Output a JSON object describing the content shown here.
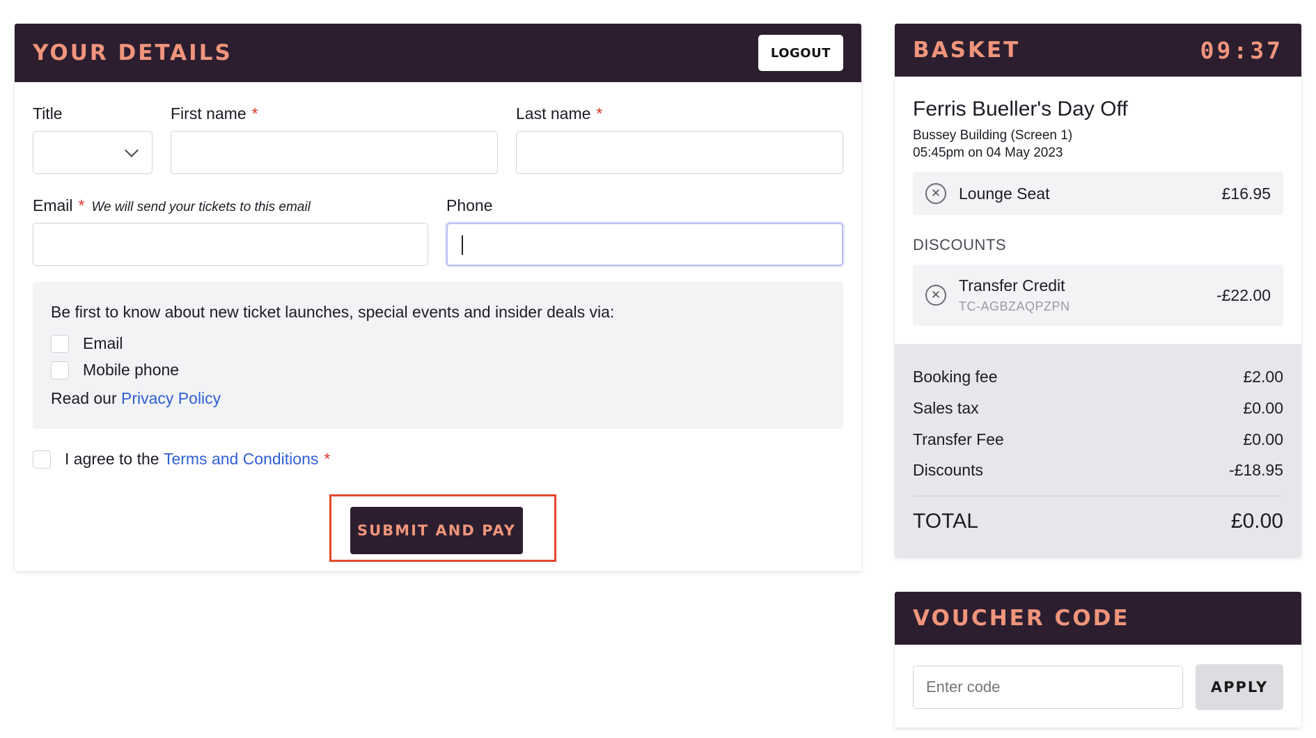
{
  "details": {
    "heading": "YOUR DETAILS",
    "logout_label": "LOGOUT",
    "title_label": "Title",
    "title_value": "",
    "first_name_label": "First name",
    "last_name_label": "Last name",
    "email_label": "Email",
    "email_hint": "We will send your tickets to this email",
    "phone_label": "Phone",
    "required_mark": "*",
    "optin_text": "Be first to know about new ticket launches, special events and insider deals via:",
    "optin_email_label": "Email",
    "optin_mobile_label": "Mobile phone",
    "policy_prefix": "Read our",
    "policy_link": "Privacy Policy",
    "agree_prefix": "I agree to the",
    "terms_link": "Terms and Conditions",
    "submit_label": "SUBMIT AND PAY"
  },
  "basket": {
    "heading": "BASKET",
    "timer": "09:37",
    "film_title": "Ferris Bueller's Day Off",
    "venue": "Bussey Building (Screen 1)",
    "showtime": "05:45pm on 04 May 2023",
    "ticket": {
      "label": "Lounge Seat",
      "price": "£16.95"
    },
    "discounts_label": "DISCOUNTS",
    "discount_item": {
      "label": "Transfer Credit",
      "code": "TC-AGBZAQPZPN",
      "amount": "-£22.00"
    },
    "summary": [
      {
        "label": "Booking fee",
        "value": "£2.00"
      },
      {
        "label": "Sales tax",
        "value": "£0.00"
      },
      {
        "label": "Transfer Fee",
        "value": "£0.00"
      },
      {
        "label": "Discounts",
        "value": "-£18.95"
      }
    ],
    "total_label": "TOTAL",
    "total_value": "£0.00"
  },
  "voucher": {
    "heading": "VOUCHER CODE",
    "placeholder": "Enter code",
    "apply_label": "APPLY"
  },
  "icons": {
    "remove": "remove-circle-icon",
    "chevron": "chevron-down-icon"
  },
  "colors": {
    "header_bg": "#2c1e2f",
    "accent": "#f0957b",
    "link": "#2f5fd6",
    "required": "#e0322b",
    "highlight": "#e5472c"
  }
}
